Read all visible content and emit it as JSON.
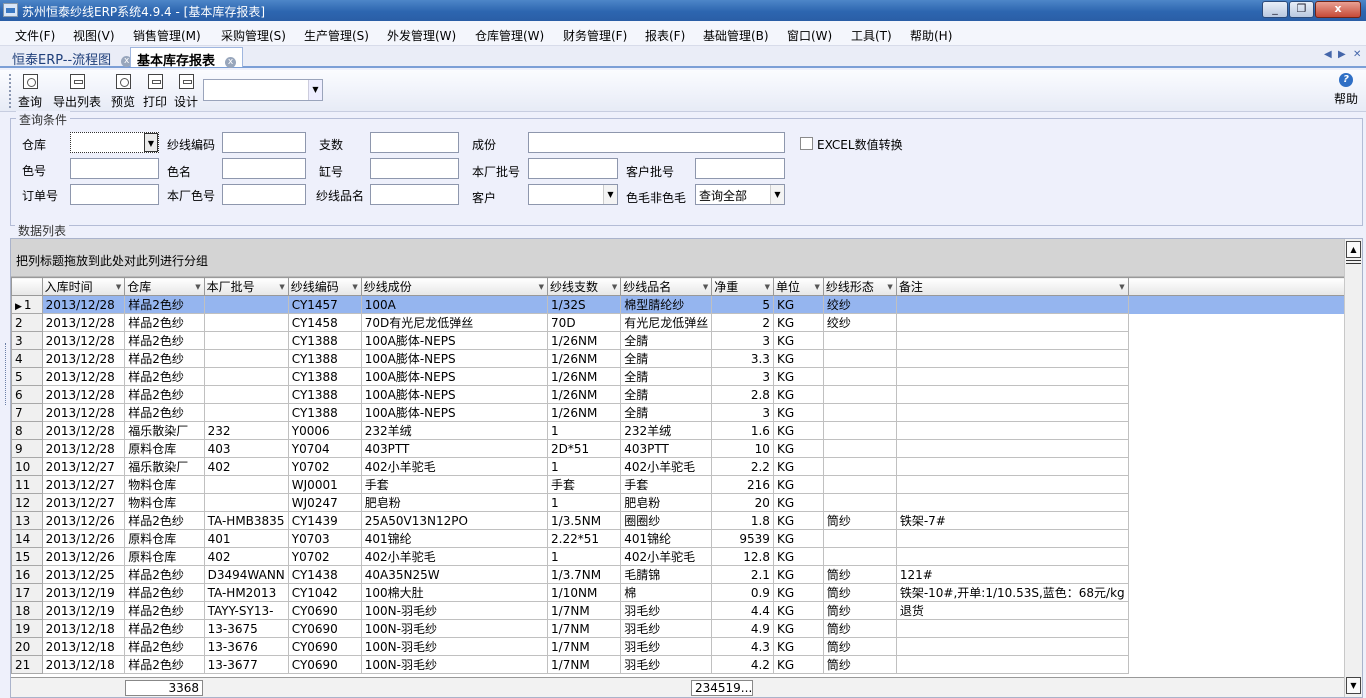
{
  "window": {
    "title": "苏州恒泰纱线ERP系统4.9.4 - [基本库存报表]",
    "min_glyph": "_",
    "max_glyph": "❐",
    "close_glyph": "x"
  },
  "menu": [
    "文件(F)",
    "视图(V)",
    "销售管理(M)",
    "采购管理(S)",
    "生产管理(S)",
    "外发管理(W)",
    "仓库管理(W)",
    "财务管理(F)",
    "报表(F)",
    "基础管理(B)",
    "窗口(W)",
    "工具(T)",
    "帮助(H)"
  ],
  "tabs": [
    {
      "label": "恒泰ERP--流程图",
      "close": "x"
    },
    {
      "label": "基本库存报表",
      "close": "x"
    }
  ],
  "tab_nav": {
    "left": "◀",
    "right": "▶",
    "close": "✕"
  },
  "toolbar": {
    "buttons": [
      "查询",
      "导出列表",
      "预览",
      "打印",
      "设计"
    ],
    "select_value": "",
    "help": "帮助",
    "help_glyph": "?"
  },
  "filter": {
    "caption": "查询条件",
    "labels": {
      "warehouse": "仓库",
      "yarn_code": "纱线编码",
      "count": "支数",
      "composition": "成份",
      "excel_convert": "EXCEL数值转换",
      "color_no": "色号",
      "color_name": "色名",
      "vat_no": "缸号",
      "factory_batch": "本厂批号",
      "customer_batch": "客户批号",
      "order_no": "订单号",
      "factory_color": "本厂色号",
      "yarn_name": "纱线品名",
      "customer": "客户",
      "color_wool": "色毛非色毛"
    },
    "values": {
      "warehouse": "",
      "color_wool": "查询全部"
    }
  },
  "grid": {
    "caption": "数据列表",
    "group_hint": "把列标题拖放到此处对此列进行分组",
    "current_row_marker": "▶",
    "sort_glyph": "▼",
    "columns": [
      "入库时间",
      "仓库",
      "本厂批号",
      "纱线编码",
      "纱线成份",
      "纱线支数",
      "纱线品名",
      "净重",
      "单位",
      "纱线形态",
      "备注"
    ],
    "rows": [
      {
        "n": "1",
        "date": "2013/12/28",
        "wh": "样品2色纱",
        "batch": "",
        "code": "CY1457",
        "comp": "100A",
        "cnt": "1/32S",
        "name": "棉型腈纶纱",
        "wt": "5",
        "unit": "KG",
        "form": "绞纱",
        "note": ""
      },
      {
        "n": "2",
        "date": "2013/12/28",
        "wh": "样品2色纱",
        "batch": "",
        "code": "CY1458",
        "comp": "70D有光尼龙低弹丝",
        "cnt": "70D",
        "name": "有光尼龙低弹丝",
        "wt": "2",
        "unit": "KG",
        "form": "绞纱",
        "note": ""
      },
      {
        "n": "3",
        "date": "2013/12/28",
        "wh": "样品2色纱",
        "batch": "",
        "code": "CY1388",
        "comp": "100A膨体-NEPS",
        "cnt": "1/26NM",
        "name": "全腈",
        "wt": "3",
        "unit": "KG",
        "form": "",
        "note": ""
      },
      {
        "n": "4",
        "date": "2013/12/28",
        "wh": "样品2色纱",
        "batch": "",
        "code": "CY1388",
        "comp": "100A膨体-NEPS",
        "cnt": "1/26NM",
        "name": "全腈",
        "wt": "3.3",
        "unit": "KG",
        "form": "",
        "note": ""
      },
      {
        "n": "5",
        "date": "2013/12/28",
        "wh": "样品2色纱",
        "batch": "",
        "code": "CY1388",
        "comp": "100A膨体-NEPS",
        "cnt": "1/26NM",
        "name": "全腈",
        "wt": "3",
        "unit": "KG",
        "form": "",
        "note": ""
      },
      {
        "n": "6",
        "date": "2013/12/28",
        "wh": "样品2色纱",
        "batch": "",
        "code": "CY1388",
        "comp": "100A膨体-NEPS",
        "cnt": "1/26NM",
        "name": "全腈",
        "wt": "2.8",
        "unit": "KG",
        "form": "",
        "note": ""
      },
      {
        "n": "7",
        "date": "2013/12/28",
        "wh": "样品2色纱",
        "batch": "",
        "code": "CY1388",
        "comp": "100A膨体-NEPS",
        "cnt": "1/26NM",
        "name": "全腈",
        "wt": "3",
        "unit": "KG",
        "form": "",
        "note": ""
      },
      {
        "n": "8",
        "date": "2013/12/28",
        "wh": "福乐散染厂",
        "batch": "232",
        "code": "Y0006",
        "comp": "232羊绒",
        "cnt": "1",
        "name": "232羊绒",
        "wt": "1.6",
        "unit": "KG",
        "form": "",
        "note": ""
      },
      {
        "n": "9",
        "date": "2013/12/28",
        "wh": "原料仓库",
        "batch": "403",
        "code": "Y0704",
        "comp": "403PTT",
        "cnt": "2D*51",
        "name": "403PTT",
        "wt": "10",
        "unit": "KG",
        "form": "",
        "note": ""
      },
      {
        "n": "10",
        "date": "2013/12/27",
        "wh": "福乐散染厂",
        "batch": "402",
        "code": "Y0702",
        "comp": "402小羊驼毛",
        "cnt": "1",
        "name": "402小羊驼毛",
        "wt": "2.2",
        "unit": "KG",
        "form": "",
        "note": ""
      },
      {
        "n": "11",
        "date": "2013/12/27",
        "wh": "物料仓库",
        "batch": "",
        "code": "WJ0001",
        "comp": "手套",
        "cnt": "手套",
        "name": "手套",
        "wt": "216",
        "unit": "KG",
        "form": "",
        "note": ""
      },
      {
        "n": "12",
        "date": "2013/12/27",
        "wh": "物料仓库",
        "batch": "",
        "code": "WJ0247",
        "comp": "肥皂粉",
        "cnt": "1",
        "name": "肥皂粉",
        "wt": "20",
        "unit": "KG",
        "form": "",
        "note": ""
      },
      {
        "n": "13",
        "date": "2013/12/26",
        "wh": "样品2色纱",
        "batch": "TA-HMB3835",
        "code": "CY1439",
        "comp": "25A50V13N12PO",
        "cnt": "1/3.5NM",
        "name": "圈圈纱",
        "wt": "1.8",
        "unit": "KG",
        "form": "筒纱",
        "note": "铁架-7#"
      },
      {
        "n": "14",
        "date": "2013/12/26",
        "wh": "原料仓库",
        "batch": "401",
        "code": "Y0703",
        "comp": "401锦纶",
        "cnt": "2.22*51",
        "name": "401锦纶",
        "wt": "9539",
        "unit": "KG",
        "form": "",
        "note": ""
      },
      {
        "n": "15",
        "date": "2013/12/26",
        "wh": "原料仓库",
        "batch": "402",
        "code": "Y0702",
        "comp": "402小羊驼毛",
        "cnt": "1",
        "name": "402小羊驼毛",
        "wt": "12.8",
        "unit": "KG",
        "form": "",
        "note": ""
      },
      {
        "n": "16",
        "date": "2013/12/25",
        "wh": "样品2色纱",
        "batch": "D3494WANN",
        "code": "CY1438",
        "comp": "40A35N25W",
        "cnt": "1/3.7NM",
        "name": "毛腈锦",
        "wt": "2.1",
        "unit": "KG",
        "form": "筒纱",
        "note": "121#"
      },
      {
        "n": "17",
        "date": "2013/12/19",
        "wh": "样品2色纱",
        "batch": "TA-HM2013",
        "code": "CY1042",
        "comp": "100棉大肚",
        "cnt": "1/10NM",
        "name": "棉",
        "wt": "0.9",
        "unit": "KG",
        "form": "筒纱",
        "note": "铁架-10#,开单:1/10.53S,蓝色：68元/kg"
      },
      {
        "n": "18",
        "date": "2013/12/19",
        "wh": "样品2色纱",
        "batch": "TAYY-SY13-",
        "code": "CY0690",
        "comp": "100N-羽毛纱",
        "cnt": "1/7NM",
        "name": "羽毛纱",
        "wt": "4.4",
        "unit": "KG",
        "form": "筒纱",
        "note": "退货"
      },
      {
        "n": "19",
        "date": "2013/12/18",
        "wh": "样品2色纱",
        "batch": "13-3675",
        "code": "CY0690",
        "comp": "100N-羽毛纱",
        "cnt": "1/7NM",
        "name": "羽毛纱",
        "wt": "4.9",
        "unit": "KG",
        "form": "筒纱",
        "note": ""
      },
      {
        "n": "20",
        "date": "2013/12/18",
        "wh": "样品2色纱",
        "batch": "13-3676",
        "code": "CY0690",
        "comp": "100N-羽毛纱",
        "cnt": "1/7NM",
        "name": "羽毛纱",
        "wt": "4.3",
        "unit": "KG",
        "form": "筒纱",
        "note": ""
      },
      {
        "n": "21",
        "date": "2013/12/18",
        "wh": "样品2色纱",
        "batch": "13-3677",
        "code": "CY0690",
        "comp": "100N-羽毛纱",
        "cnt": "1/7NM",
        "name": "羽毛纱",
        "wt": "4.2",
        "unit": "KG",
        "form": "筒纱",
        "note": ""
      }
    ],
    "footer": {
      "count": "3368",
      "weight_sum": "234519..."
    },
    "scroll_up": "▲",
    "scroll_down": "▼"
  }
}
